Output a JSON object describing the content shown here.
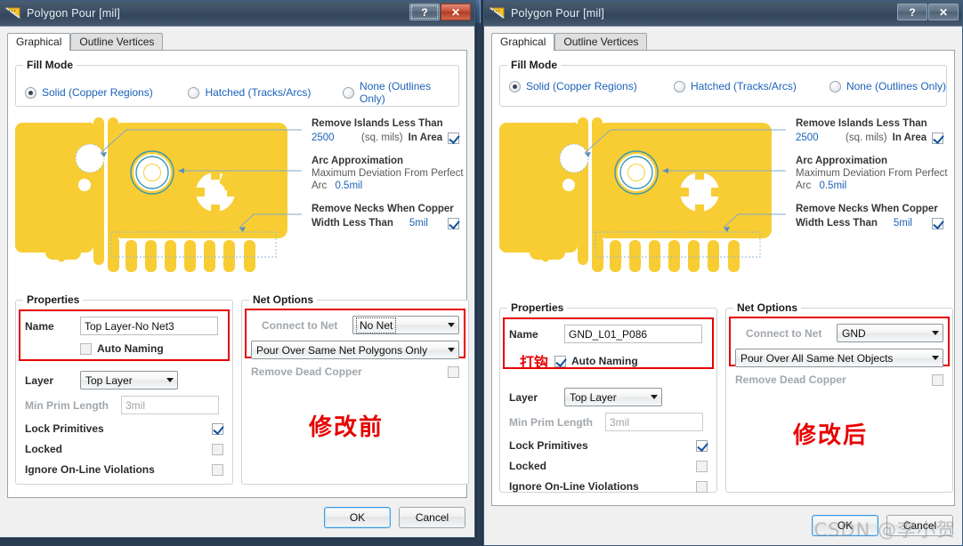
{
  "background_window": {
    "label_left": "Top Layer",
    "label_right": "No Net"
  },
  "watermark": "CSDN @李小贺",
  "dialogs": [
    {
      "id": "before",
      "title": "Polygon Pour [mil]",
      "icon": "polygon-pour-icon",
      "titlebar_buttons": {
        "help": "?",
        "close": "✕"
      },
      "tabs": [
        {
          "label": "Graphical",
          "active": true
        },
        {
          "label": "Outline Vertices",
          "active": false
        }
      ],
      "fill_mode": {
        "legend": "Fill Mode",
        "options": [
          {
            "label": "Solid (Copper Regions)",
            "selected": true
          },
          {
            "label": "Hatched (Tracks/Arcs)",
            "selected": false
          },
          {
            "label": "None (Outlines Only)",
            "selected": false
          }
        ]
      },
      "callouts": {
        "remove_islands": {
          "title": "Remove Islands Less Than",
          "value": "2500",
          "units": "(sq. mils)",
          "suffix": "In Area",
          "checked": true
        },
        "arc_approximation": {
          "title": "Arc Approximation",
          "sub1": "Maximum Deviation From Perfect",
          "sub2_label": "Arc",
          "sub2_value": "0.5mil"
        },
        "remove_necks": {
          "title": "Remove Necks When Copper",
          "sub_label": "Width Less Than",
          "value": "5mil",
          "checked": true
        }
      },
      "properties": {
        "legend": "Properties",
        "name_label": "Name",
        "name_value": "Top Layer-No Net3",
        "auto_naming_label": "Auto Naming",
        "auto_naming_checked": false,
        "layer_label": "Layer",
        "layer_value": "Top Layer",
        "min_prim_label": "Min Prim Length",
        "min_prim_value": "3mil",
        "lock_primitives_label": "Lock Primitives",
        "lock_primitives_checked": true,
        "locked_label": "Locked",
        "locked_checked": false,
        "ignore_label": "Ignore On-Line Violations",
        "ignore_checked": false
      },
      "net_options": {
        "legend": "Net Options",
        "connect_label": "Connect to Net",
        "connect_value": "No Net",
        "pour_value": "Pour Over Same Net Polygons Only",
        "remove_dead_copper_label": "Remove Dead Copper",
        "remove_dead_copper_checked": false
      },
      "annotation": "修改前",
      "annotation_small": "",
      "footer": {
        "ok": "OK",
        "cancel": "Cancel"
      }
    },
    {
      "id": "after",
      "title": "Polygon Pour [mil]",
      "icon": "polygon-pour-icon",
      "titlebar_buttons": {
        "help": "?",
        "close": "✕"
      },
      "tabs": [
        {
          "label": "Graphical",
          "active": true
        },
        {
          "label": "Outline Vertices",
          "active": false
        }
      ],
      "fill_mode": {
        "legend": "Fill Mode",
        "options": [
          {
            "label": "Solid (Copper Regions)",
            "selected": true
          },
          {
            "label": "Hatched (Tracks/Arcs)",
            "selected": false
          },
          {
            "label": "None (Outlines Only)",
            "selected": false
          }
        ]
      },
      "callouts": {
        "remove_islands": {
          "title": "Remove Islands Less Than",
          "value": "2500",
          "units": "(sq. mils)",
          "suffix": "In Area",
          "checked": true
        },
        "arc_approximation": {
          "title": "Arc Approximation",
          "sub1": "Maximum Deviation From Perfect",
          "sub2_label": "Arc",
          "sub2_value": "0.5mil"
        },
        "remove_necks": {
          "title": "Remove Necks When Copper",
          "sub_label": "Width Less Than",
          "value": "5mil",
          "checked": true
        }
      },
      "properties": {
        "legend": "Properties",
        "name_label": "Name",
        "name_value": "GND_L01_P086",
        "auto_naming_label": "Auto Naming",
        "auto_naming_checked": true,
        "layer_label": "Layer",
        "layer_value": "Top Layer",
        "min_prim_label": "Min Prim Length",
        "min_prim_value": "3mil",
        "lock_primitives_label": "Lock Primitives",
        "lock_primitives_checked": true,
        "locked_label": "Locked",
        "locked_checked": false,
        "ignore_label": "Ignore On-Line Violations",
        "ignore_checked": false
      },
      "net_options": {
        "legend": "Net Options",
        "connect_label": "Connect to Net",
        "connect_value": "GND",
        "pour_value": "Pour Over All Same Net Objects",
        "remove_dead_copper_label": "Remove Dead Copper",
        "remove_dead_copper_checked": false
      },
      "annotation": "修改后",
      "annotation_small": "打钩",
      "footer": {
        "ok": "OK",
        "cancel": "Cancel"
      }
    }
  ],
  "colors": {
    "copper": "#F8CD34",
    "accent_blue": "#1c62b9",
    "annotation_red": "#e60000",
    "titlebar": "#3c4e63"
  }
}
